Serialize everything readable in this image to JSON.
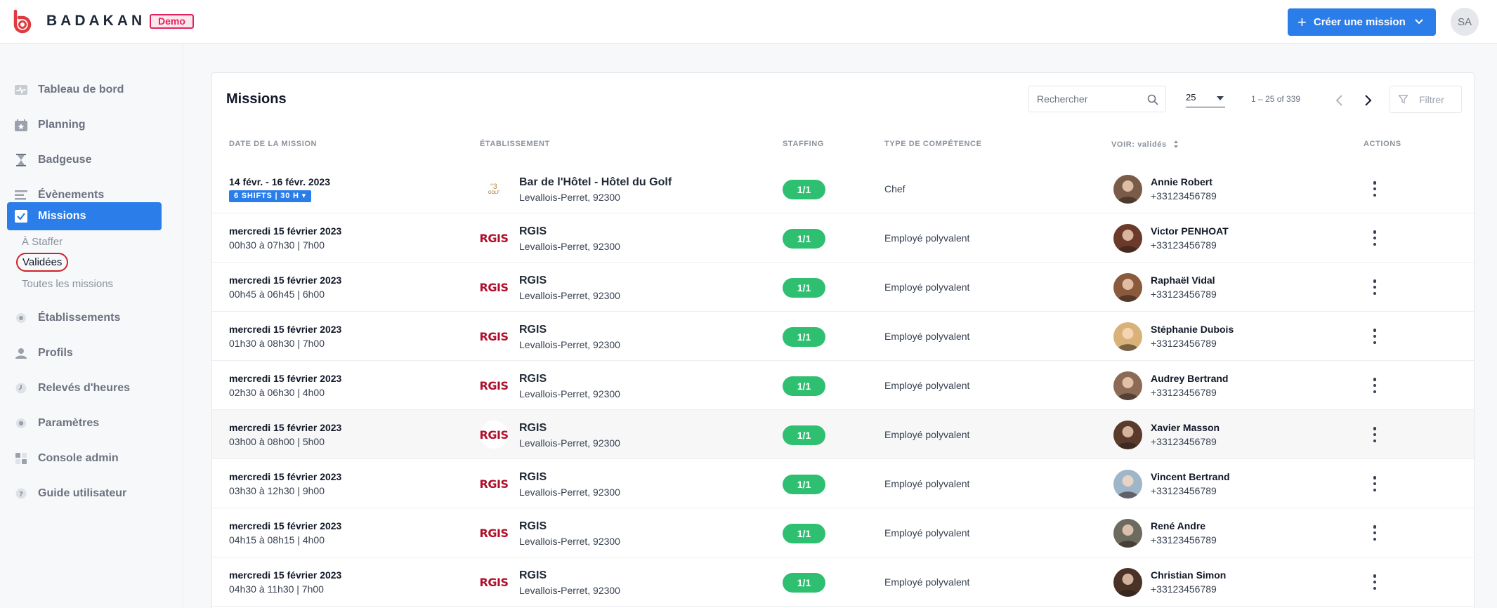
{
  "brand": {
    "name": "BADAKAN",
    "env_badge": "Demo"
  },
  "header": {
    "create_label": "Créer une mission",
    "user_initials": "SA"
  },
  "sidebar": {
    "items": [
      {
        "label": "Tableau de bord",
        "icon": "pulse-icon"
      },
      {
        "label": "Planning",
        "icon": "calendar-star-icon"
      },
      {
        "label": "Badgeuse",
        "icon": "hourglass-icon"
      },
      {
        "label": "Évènements",
        "icon": "list-icon"
      },
      {
        "label": "Missions",
        "icon": "checkbox-icon",
        "active": true
      },
      {
        "label": "Établissements",
        "icon": "building-icon"
      },
      {
        "label": "Profils",
        "icon": "user-icon"
      },
      {
        "label": "Relevés d'heures",
        "icon": "clock-icon"
      },
      {
        "label": "Paramètres",
        "icon": "gear-icon"
      },
      {
        "label": "Console admin",
        "icon": "grid-icon"
      },
      {
        "label": "Guide utilisateur",
        "icon": "help-icon"
      }
    ],
    "mission_subitems": [
      "À Staffer",
      "Validées",
      "Toutes les missions"
    ]
  },
  "missions": {
    "title": "Missions",
    "search_placeholder": "Rechercher",
    "per_page": "25",
    "range": "1 – 25 of 339",
    "filter_label": "Filtrer",
    "columns": {
      "date": "DATE DE LA MISSION",
      "establishment": "ÉTABLISSEMENT",
      "staffing": "STAFFING",
      "skill": "TYPE DE COMPÉTENCE",
      "view": "VOIR: validés",
      "actions": "ACTIONS"
    },
    "rows": [
      {
        "date": "14 févr. - 16 févr. 2023",
        "shifts_badge": "6 SHIFTS | 30 H",
        "time": "",
        "logo": "hotel",
        "name": "Bar de l'Hôtel - Hôtel du Golf",
        "address": "Levallois-Perret, 92300",
        "staffing": "1/1",
        "skill": "Chef",
        "person": "Annie Robert",
        "phone": "+33123456789",
        "avatar_color": "#7a5b48"
      },
      {
        "date": "mercredi 15 février 2023",
        "shifts_badge": "",
        "time": "00h30 à 07h30 | 7h00",
        "logo": "rgis",
        "name": "RGIS",
        "address": "Levallois-Perret, 92300",
        "staffing": "1/1",
        "skill": "Employé polyvalent",
        "person": "Victor PENHOAT",
        "phone": "+33123456789",
        "avatar_color": "#6b3a2a"
      },
      {
        "date": "mercredi 15 février 2023",
        "shifts_badge": "",
        "time": "00h45 à 06h45 | 6h00",
        "logo": "rgis",
        "name": "RGIS",
        "address": "Levallois-Perret, 92300",
        "staffing": "1/1",
        "skill": "Employé polyvalent",
        "person": "Raphaël Vidal",
        "phone": "+33123456789",
        "avatar_color": "#8a5a3c"
      },
      {
        "date": "mercredi 15 février 2023",
        "shifts_badge": "",
        "time": "01h30 à 08h30 | 7h00",
        "logo": "rgis",
        "name": "RGIS",
        "address": "Levallois-Perret, 92300",
        "staffing": "1/1",
        "skill": "Employé polyvalent",
        "person": "Stéphanie Dubois",
        "phone": "+33123456789",
        "avatar_color": "#d9b27a"
      },
      {
        "date": "mercredi 15 février 2023",
        "shifts_badge": "",
        "time": "02h30 à 06h30 | 4h00",
        "logo": "rgis",
        "name": "RGIS",
        "address": "Levallois-Perret, 92300",
        "staffing": "1/1",
        "skill": "Employé polyvalent",
        "person": "Audrey Bertrand",
        "phone": "+33123456789",
        "avatar_color": "#8c6a55"
      },
      {
        "date": "mercredi 15 février 2023",
        "shifts_badge": "",
        "time": "03h00 à 08h00 | 5h00",
        "logo": "rgis",
        "name": "RGIS",
        "address": "Levallois-Perret, 92300",
        "staffing": "1/1",
        "skill": "Employé polyvalent",
        "person": "Xavier Masson",
        "phone": "+33123456789",
        "avatar_color": "#5a3a2a",
        "highlight": true
      },
      {
        "date": "mercredi 15 février 2023",
        "shifts_badge": "",
        "time": "03h30 à 12h30 | 9h00",
        "logo": "rgis",
        "name": "RGIS",
        "address": "Levallois-Perret, 92300",
        "staffing": "1/1",
        "skill": "Employé polyvalent",
        "person": "Vincent Bertrand",
        "phone": "+33123456789",
        "avatar_color": "#9fb6c8"
      },
      {
        "date": "mercredi 15 février 2023",
        "shifts_badge": "",
        "time": "04h15 à 08h15 | 4h00",
        "logo": "rgis",
        "name": "RGIS",
        "address": "Levallois-Perret, 92300",
        "staffing": "1/1",
        "skill": "Employé polyvalent",
        "person": "René Andre",
        "phone": "+33123456789",
        "avatar_color": "#6d6a60"
      },
      {
        "date": "mercredi 15 février 2023",
        "shifts_badge": "",
        "time": "04h30 à 11h30 | 7h00",
        "logo": "rgis",
        "name": "RGIS",
        "address": "Levallois-Perret, 92300",
        "staffing": "1/1",
        "skill": "Employé polyvalent",
        "person": "Christian Simon",
        "phone": "+33123456789",
        "avatar_color": "#4a3226"
      }
    ]
  }
}
